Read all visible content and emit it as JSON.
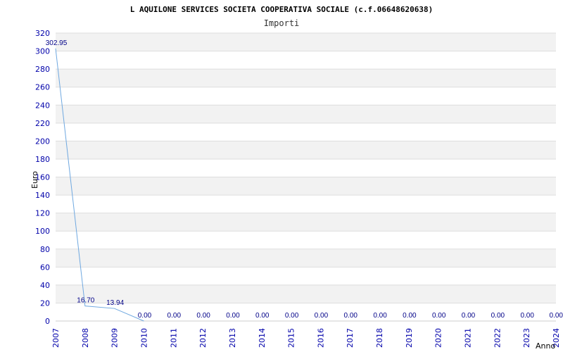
{
  "chart_data": {
    "type": "line",
    "title": "L AQUILONE SERVICES SOCIETA COOPERATIVA SOCIALE (c.f.06648620638)",
    "subtitle": "Importi",
    "xlabel": "Anno",
    "ylabel": "Euro",
    "ylim": [
      0,
      320
    ],
    "yticks": [
      0,
      20,
      40,
      60,
      80,
      100,
      120,
      140,
      160,
      180,
      200,
      220,
      240,
      260,
      280,
      300,
      320
    ],
    "categories": [
      "2007",
      "2008",
      "2009",
      "2010",
      "2011",
      "2012",
      "2013",
      "2014",
      "2015",
      "2016",
      "2017",
      "2018",
      "2019",
      "2020",
      "2021",
      "2022",
      "2023",
      "2024"
    ],
    "series": [
      {
        "values": [
          302.95,
          16.7,
          13.94,
          0.0,
          0.0,
          0.0,
          0.0,
          0.0,
          0.0,
          0.0,
          0.0,
          0.0,
          0.0,
          0.0,
          0.0,
          0.0,
          0.0,
          0.0
        ],
        "labels": [
          "302.95",
          "16.70",
          "13.94",
          "0.00",
          "0.00",
          "0.00",
          "0.00",
          "0.00",
          "0.00",
          "0.00",
          "0.00",
          "0.00",
          "0.00",
          "0.00",
          "0.00",
          "0.00",
          "0.00",
          "0.00"
        ]
      }
    ],
    "grid": true,
    "colors": {
      "line": "#6fa8e0",
      "band": "#f2f2f2",
      "gridline": "#dddddd",
      "tick": "#0000aa",
      "data_label": "#000088"
    }
  }
}
